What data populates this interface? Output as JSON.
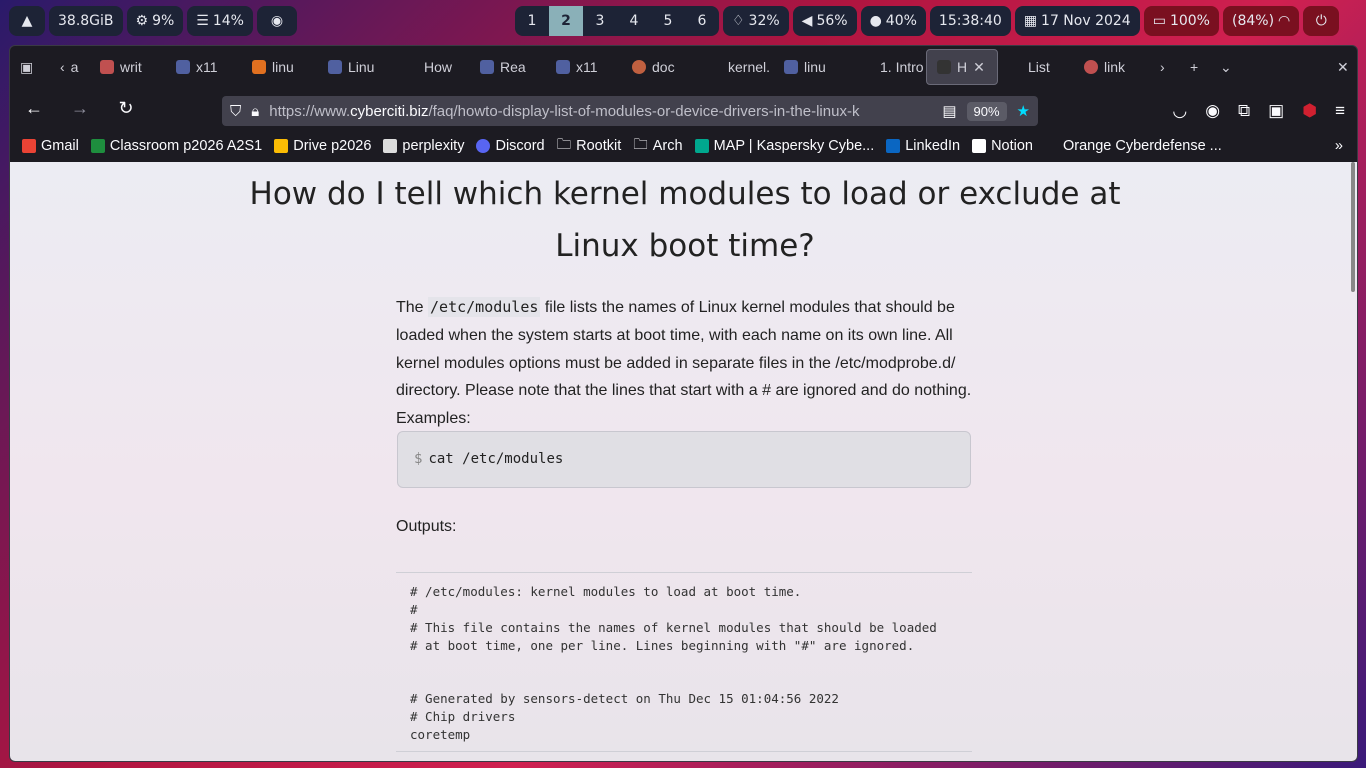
{
  "topbar": {
    "memory": "38.8GiB",
    "cpu": "9%",
    "disk": "14%",
    "workspaces": [
      "1",
      "2",
      "3",
      "4",
      "5",
      "6"
    ],
    "active_workspace": "2",
    "brightness": "32%",
    "volume": "56%",
    "mic": "40%",
    "time": "15:38:40",
    "date": "17 Nov 2024",
    "battery_a": "100%",
    "battery_b": "(84%)"
  },
  "tabs": [
    {
      "label": "a"
    },
    {
      "label": "writ"
    },
    {
      "label": "x11"
    },
    {
      "label": "linu"
    },
    {
      "label": "Linu"
    },
    {
      "label": "How"
    },
    {
      "label": "Rea"
    },
    {
      "label": "x11"
    },
    {
      "label": "doc"
    },
    {
      "label": "kernel."
    },
    {
      "label": "linu"
    },
    {
      "label": "1. Intro"
    },
    {
      "label": "H"
    },
    {
      "label": "List"
    },
    {
      "label": "link"
    }
  ],
  "urlbar": {
    "prefix": "https://www.",
    "domain": "cyberciti.biz",
    "path": "/faq/howto-display-list-of-modules-or-device-drivers-in-the-linux-k",
    "zoom": "90%"
  },
  "bookmarks": [
    {
      "label": "Gmail",
      "color": "#ea4335"
    },
    {
      "label": "Classroom p2026 A2S1",
      "color": "#1e8e3e"
    },
    {
      "label": "Drive p2026",
      "color": "#fbbc04"
    },
    {
      "label": "perplexity",
      "color": "#ffffff"
    },
    {
      "label": "Discord",
      "color": "#5865f2"
    },
    {
      "label": "Rootkit",
      "color": "#00000000"
    },
    {
      "label": "Arch",
      "color": "#00000000"
    },
    {
      "label": "MAP | Kaspersky Cybe...",
      "color": "#00a88e"
    },
    {
      "label": "LinkedIn",
      "color": "#0a66c2"
    },
    {
      "label": "Notion",
      "color": "#ffffff"
    },
    {
      "label": "Orange Cyberdefense ...",
      "color": "#00000000"
    }
  ],
  "article": {
    "title": "How do I tell which kernel modules to load or exclude at Linux boot time?",
    "para_pre": "The ",
    "para_code": "/etc/modules",
    "para_post": " file lists the names of Linux kernel modules that should be loaded when the system starts at boot time, with each name on its own line. All kernel modules options must be added in separate files in the /etc/modprobe.d/ directory. Please note that the lines that start with a # are ignored and do nothing. Examples:",
    "prompt": "$",
    "command": "cat /etc/modules",
    "outputs_label": "Outputs:",
    "output": "# /etc/modules: kernel modules to load at boot time.\n#\n# This file contains the names of kernel modules that should be loaded\n# at boot time, one per line. Lines beginning with \"#\" are ignored.\n\n\n# Generated by sensors-detect on Thu Dec 15 01:04:56 2022\n# Chip drivers\ncoretemp"
  },
  "colors": {
    "accent": "#8ab0b8",
    "bar": "#1d2336"
  }
}
